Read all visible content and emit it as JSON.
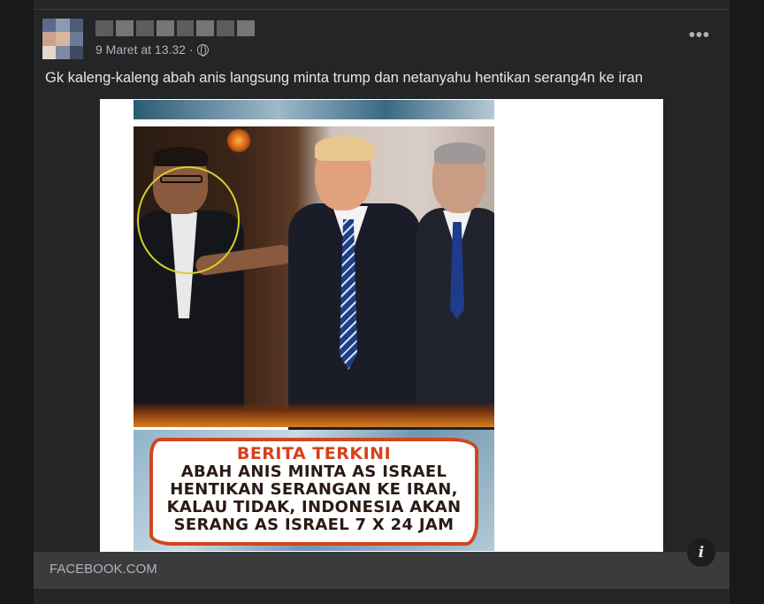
{
  "post": {
    "timestamp": "9 Maret at 13.32",
    "visibility_separator": "·",
    "visibility_icon": "globe-icon",
    "more_icon": "more-options-icon",
    "more_label": "•••",
    "caption": "Gk kaleng-kaleng abah anis langsung minta trump dan netanyahu hentikan serang4n ke iran"
  },
  "poster": {
    "banner_title": "BERITA TERKINI",
    "banner_lines": [
      "ABAH ANIS MINTA AS ISRAEL",
      "HENTIKAN SERANGAN KE IRAN,",
      "KALAU TIDAK, INDONESIA AKAN",
      "SERANG AS ISRAEL 7 X 24 JAM"
    ]
  },
  "link_preview": {
    "domain": "FACEBOOK.COM",
    "info_icon": "info-icon",
    "info_label": "i"
  },
  "colors": {
    "page_background": "#18191a",
    "card_background": "#242526",
    "footer_background": "#3a3b3c",
    "primary_text": "#e4e6eb",
    "secondary_text": "#b0b3b8",
    "banner_title_color": "#d8401b",
    "banner_border": "#d2451e",
    "highlight_circle": "#d4cf2c"
  }
}
